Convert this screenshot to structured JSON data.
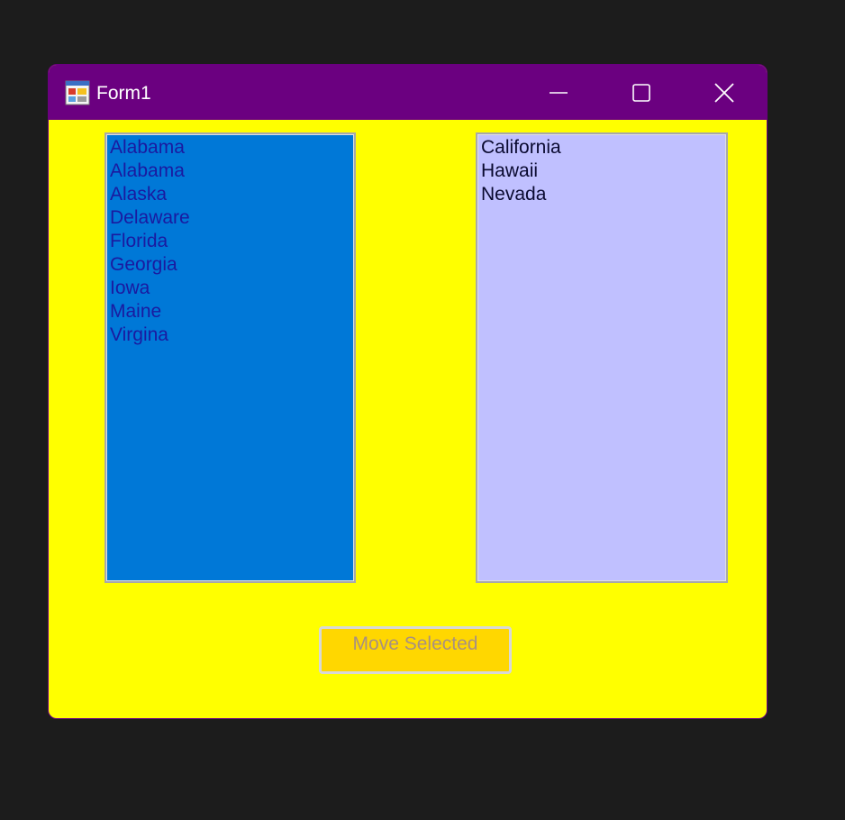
{
  "window": {
    "title": "Form1",
    "controls": {
      "minimize_icon": "minimize-icon",
      "maximize_icon": "maximize-icon",
      "close_icon": "close-icon"
    },
    "colors": {
      "titlebar": "#6b0080",
      "form_background": "#ffff00"
    }
  },
  "left_list": {
    "items": [
      "Alabama",
      "Alabama",
      "Alaska",
      "Delaware",
      "Florida",
      "Georgia",
      "Iowa",
      "Maine",
      "Virgina"
    ],
    "background": "#0078d7"
  },
  "right_list": {
    "items": [
      "California",
      "Hawaii",
      "Nevada"
    ],
    "background": "#c0c0ff"
  },
  "move_button": {
    "label": "Move Selected",
    "background": "#ffd700"
  }
}
